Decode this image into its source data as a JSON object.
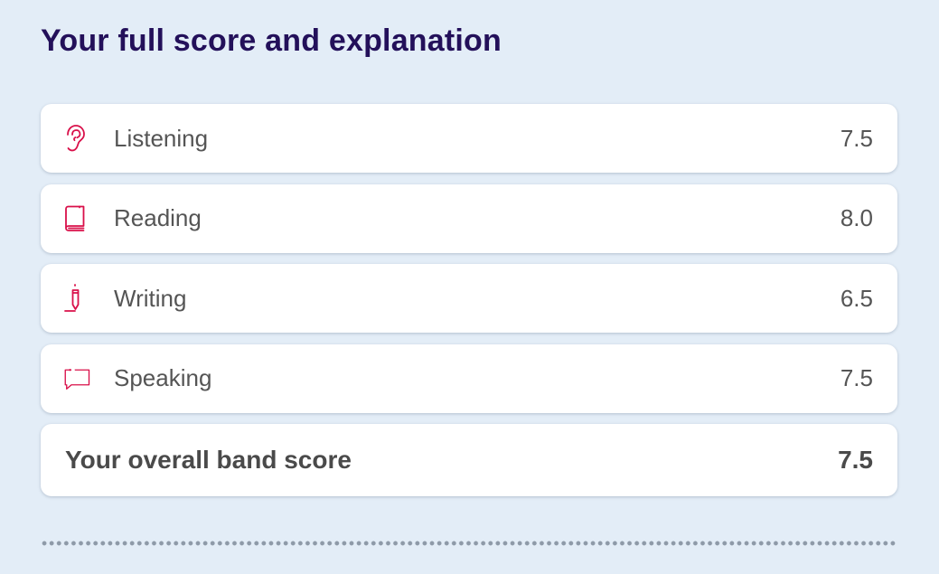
{
  "page": {
    "title": "Your full score and explanation"
  },
  "scores": {
    "items": [
      {
        "label": "Listening",
        "score": "7.5",
        "icon": "ear-icon"
      },
      {
        "label": "Reading",
        "score": "8.0",
        "icon": "book-icon"
      },
      {
        "label": "Writing",
        "score": "6.5",
        "icon": "pen-icon"
      },
      {
        "label": "Speaking",
        "score": "7.5",
        "icon": "speech-bubble-icon"
      }
    ],
    "overall": {
      "label": "Your overall band score",
      "score": "7.5"
    }
  },
  "colors": {
    "background": "#e3edf7",
    "title": "#23105a",
    "icon_accent": "#d9104a",
    "text": "#555555"
  }
}
